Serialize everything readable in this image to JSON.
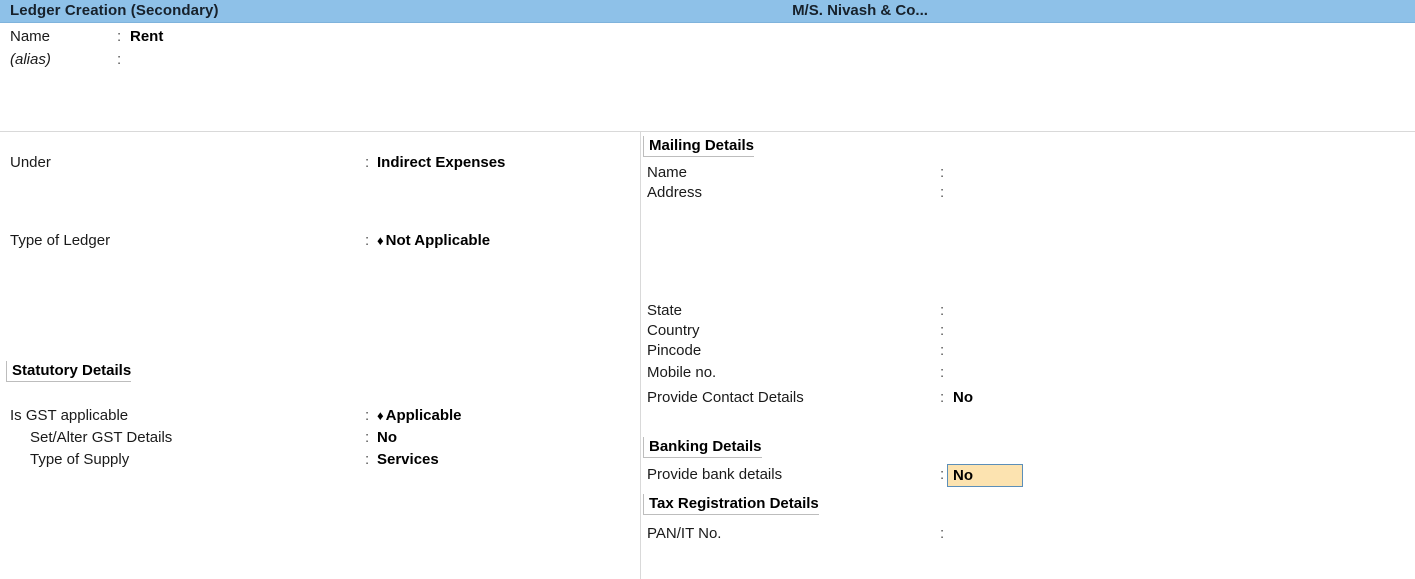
{
  "titlebar": {
    "screen_title": "Ledger Creation (Secondary)",
    "company_title": "M/S. Nivash & Co...",
    "bar_color": "#8EC1E8"
  },
  "header_fields": [
    {
      "label": "Name",
      "colon": ":",
      "value": "Rent"
    },
    {
      "label": "(alias)",
      "colon": ":",
      "value": ""
    }
  ],
  "left_panel": {
    "under": {
      "label": "Under",
      "colon": ":",
      "value": "Indirect Expenses"
    },
    "type_of_ledger": {
      "label": "Type of Ledger",
      "colon": ":",
      "marker": "♦",
      "value": "Not Applicable"
    },
    "statutory_heading": "Statutory Details",
    "statutory_fields": [
      {
        "label": "Is GST applicable",
        "colon": ":",
        "marker": "♦",
        "value": "Applicable"
      },
      {
        "label": "Set/Alter GST Details",
        "colon": ":",
        "marker": "",
        "value": "No"
      },
      {
        "label": "Type of Supply",
        "colon": ":",
        "marker": "",
        "value": "Services"
      }
    ]
  },
  "right_panel": {
    "mailing_heading": "Mailing Details",
    "mailing_fields": [
      {
        "label": "Name",
        "colon": ":",
        "value": ""
      },
      {
        "label": "Address",
        "colon": ":",
        "value": ""
      }
    ],
    "location_fields": [
      {
        "label": "State",
        "colon": ":",
        "value": ""
      },
      {
        "label": "Country",
        "colon": ":",
        "value": ""
      },
      {
        "label": "Pincode",
        "colon": ":",
        "value": ""
      },
      {
        "label": "Mobile no.",
        "colon": ":",
        "value": ""
      },
      {
        "label": "Provide Contact Details",
        "colon": ":",
        "value": "No"
      }
    ],
    "banking_heading": "Banking Details",
    "banking_field": {
      "label": "Provide bank details",
      "colon": ":",
      "value": "No"
    },
    "tax_heading": "Tax Registration Details",
    "tax_fields": [
      {
        "label": "PAN/IT No.",
        "colon": ":",
        "value": ""
      }
    ]
  },
  "colors": {
    "titlebar": "#8EC1E8",
    "active_field_bg": "#FCE3B0",
    "active_field_border": "#5C8FB9",
    "divider": "#D9D9D9",
    "heading_rule": "#BDBDBD"
  }
}
